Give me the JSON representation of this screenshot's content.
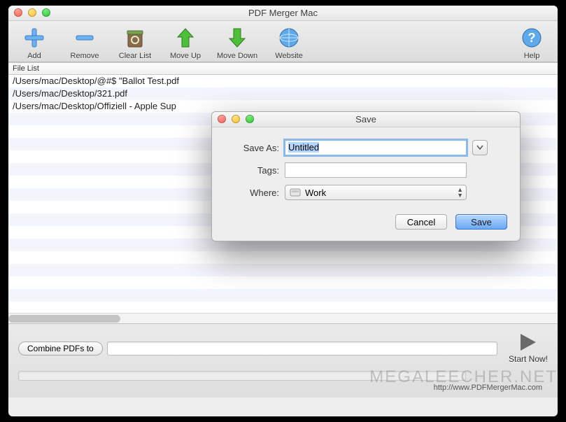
{
  "window": {
    "title": "PDF Merger Mac"
  },
  "toolbar": {
    "add": "Add",
    "remove": "Remove",
    "clearlist": "Clear List",
    "moveup": "Move Up",
    "movedown": "Move Down",
    "website": "Website",
    "help": "Help"
  },
  "filelist": {
    "header": "File List",
    "items": [
      "/Users/mac/Desktop/@#$ \"Ballot Test.pdf",
      "/Users/mac/Desktop/321.pdf",
      "/Users/mac/Desktop/Offiziell - Apple Sup"
    ]
  },
  "bottom": {
    "combine_label": "Combine PDFs to",
    "combine_value": "",
    "start_label": "Start Now!",
    "footer_url": "http://www.PDFMergerMac.com"
  },
  "dialog": {
    "title": "Save",
    "saveas_label": "Save As:",
    "saveas_value": "Untitled",
    "tags_label": "Tags:",
    "tags_value": "",
    "where_label": "Where:",
    "where_value": "Work",
    "cancel": "Cancel",
    "save": "Save"
  },
  "watermark": "MEGALEECHER.NET"
}
